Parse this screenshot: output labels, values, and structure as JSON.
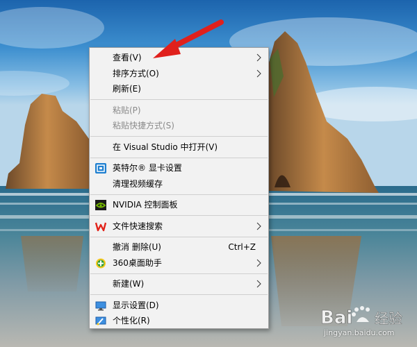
{
  "context_menu": {
    "items": [
      {
        "label": "查看(V)",
        "submenu": true,
        "disabled": false
      },
      {
        "label": "排序方式(O)",
        "submenu": true,
        "disabled": false
      },
      {
        "label": "刷新(E)",
        "submenu": false,
        "disabled": false
      },
      {
        "label": "粘贴(P)",
        "submenu": false,
        "disabled": true
      },
      {
        "label": "粘贴快捷方式(S)",
        "submenu": false,
        "disabled": true
      },
      {
        "label": "在 Visual Studio 中打开(V)",
        "submenu": false,
        "disabled": false
      },
      {
        "label": "英特尔® 显卡设置",
        "submenu": false,
        "disabled": false,
        "icon": "intel-graphics-icon"
      },
      {
        "label": "清理视频缓存",
        "submenu": false,
        "disabled": false
      },
      {
        "label": "NVIDIA 控制面板",
        "submenu": false,
        "disabled": false,
        "icon": "nvidia-icon"
      },
      {
        "label": "文件快速搜索",
        "submenu": true,
        "disabled": false,
        "icon": "wps-icon"
      },
      {
        "label": "撤消 删除(U)",
        "shortcut": "Ctrl+Z",
        "submenu": false,
        "disabled": false
      },
      {
        "label": "360桌面助手",
        "submenu": true,
        "disabled": false,
        "icon": "360-icon"
      },
      {
        "label": "新建(W)",
        "submenu": true,
        "disabled": false
      },
      {
        "label": "显示设置(D)",
        "submenu": false,
        "disabled": false,
        "icon": "display-settings-icon"
      },
      {
        "label": "个性化(R)",
        "submenu": false,
        "disabled": false,
        "icon": "personalize-icon"
      }
    ]
  },
  "watermark": {
    "brand": "Baidu经验",
    "url": "jingyan.baidu.com"
  },
  "colors": {
    "menu_background": "#f2f2f2",
    "annotation_arrow": "#e0201c",
    "disabled_text": "#8a8a8a"
  }
}
